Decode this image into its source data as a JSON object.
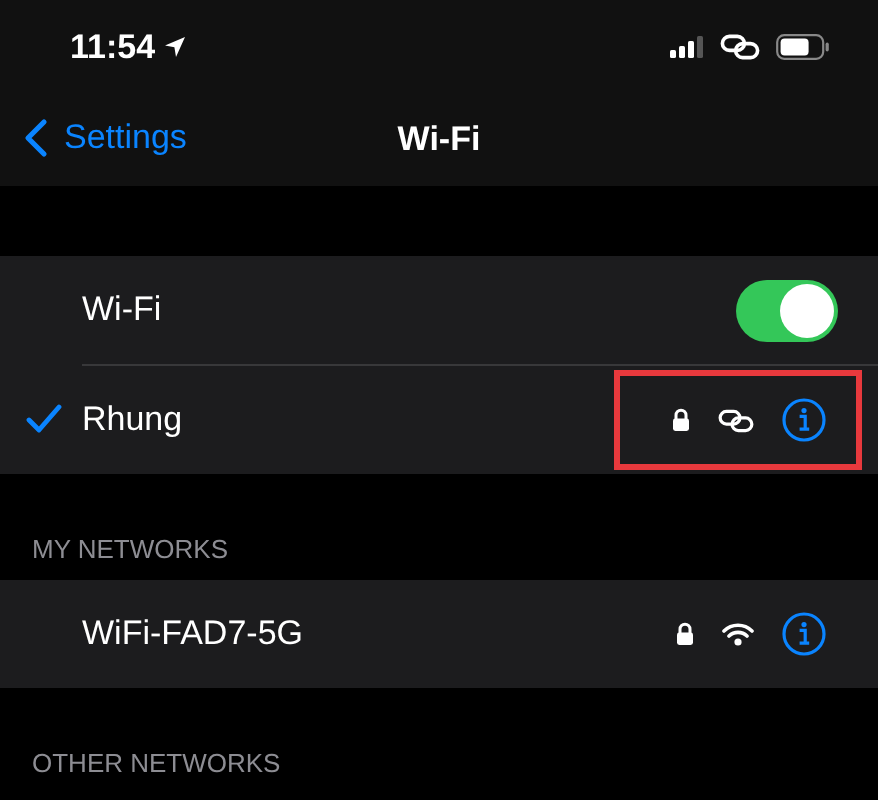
{
  "status_bar": {
    "time": "11:54"
  },
  "nav": {
    "back": "Settings",
    "title": "Wi-Fi"
  },
  "wifi_toggle": {
    "label": "Wi-Fi",
    "on": true
  },
  "current_network": {
    "name": "Rhung",
    "selected": true,
    "locked": true,
    "kind": "hotspot",
    "highlighted": true
  },
  "sections": [
    {
      "header": "MY NETWORKS",
      "networks": [
        {
          "name": "WiFi-FAD7-5G",
          "locked": true,
          "kind": "wifi"
        }
      ]
    },
    {
      "header": "OTHER NETWORKS"
    }
  ]
}
